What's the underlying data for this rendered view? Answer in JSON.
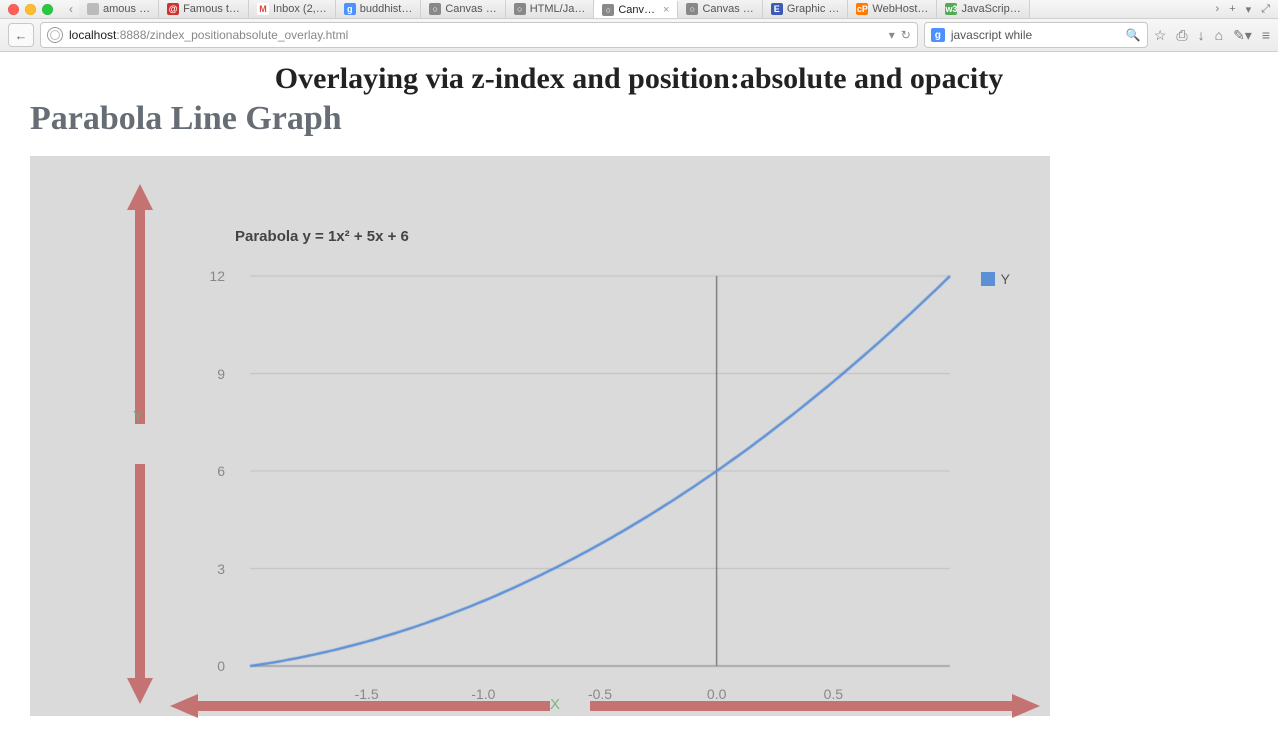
{
  "browser": {
    "tabs": [
      {
        "label": "amous …",
        "fav": "#bbb",
        "favTxt": ""
      },
      {
        "label": "Famous t…",
        "fav": "#c33",
        "favTxt": "@"
      },
      {
        "label": "Inbox (2,…",
        "fav": "#fff",
        "favTxt": "M",
        "favColor": "#d44"
      },
      {
        "label": "buddhist…",
        "fav": "#4d90fe",
        "favTxt": "g"
      },
      {
        "label": "Canvas …",
        "fav": "#888",
        "favTxt": "○"
      },
      {
        "label": "HTML/Ja…",
        "fav": "#888",
        "favTxt": "○"
      },
      {
        "label": "Canv…",
        "fav": "#888",
        "favTxt": "○",
        "active": true,
        "close": true
      },
      {
        "label": "Canvas …",
        "fav": "#888",
        "favTxt": "○"
      },
      {
        "label": "Graphic …",
        "fav": "#3b5bb5",
        "favTxt": "E"
      },
      {
        "label": "WebHost…",
        "fav": "#ff7a00",
        "favTxt": "cP"
      },
      {
        "label": "JavaScrip…",
        "fav": "#5a5",
        "favTxt": "w3"
      }
    ],
    "url_host": "localhost",
    "url_rest": ":8888/zindex_positionabsolute_overlay.html",
    "search_value": "javascript while",
    "nav": {
      "back": "←",
      "dropdown": "▾",
      "reload": "↻",
      "magnify": "🔍"
    },
    "tool": {
      "star": "☆",
      "clipboard": "⎙",
      "down": "↓",
      "home": "⌂",
      "brush": "✎▾",
      "menu": "≡",
      "chevR": "›",
      "plus": "+",
      "more": "▾",
      "expand": "⤢"
    }
  },
  "content": {
    "title": "Overlaying via z-index and position:absolute and opacity",
    "subtitle": "Parabola Line Graph",
    "axisY": "Y",
    "axisX": "X"
  },
  "chart_data": {
    "type": "line",
    "title": "Parabola y = 1x² + 5x + 6",
    "legend": "Y",
    "xlabel": "",
    "ylabel": "",
    "x": [
      -2.0,
      -1.5,
      -1.0,
      -0.5,
      0.0,
      0.5,
      1.0
    ],
    "values": [
      0,
      0.75,
      2,
      3.75,
      6,
      8.75,
      12
    ],
    "xticks": [
      -1.5,
      -1.0,
      -0.5,
      0.0,
      0.5
    ],
    "yticks": [
      0,
      3,
      6,
      9,
      12
    ],
    "xlim": [
      -2.0,
      1.0
    ],
    "ylim": [
      0,
      12
    ],
    "zeroLineX": 0.0,
    "series": [
      {
        "name": "Y",
        "color": "#5b8fd6"
      }
    ]
  }
}
